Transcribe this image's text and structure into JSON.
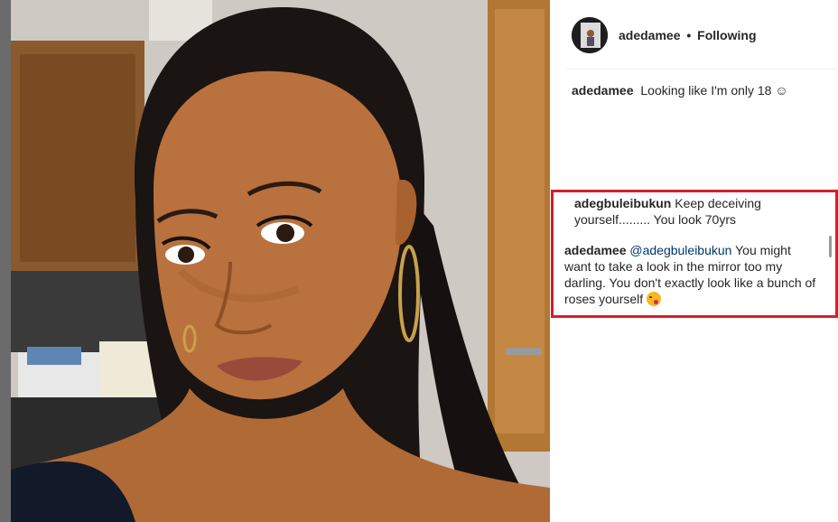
{
  "post": {
    "author": "adedamee",
    "separator": "•",
    "follow_status": "Following",
    "caption_author": "adedamee",
    "caption_text": "Looking like I'm only 18 ☺"
  },
  "comments": [
    {
      "author": "adegbuleibukun",
      "text": "Keep deceiving yourself......... You look 70yrs"
    },
    {
      "author": "adedamee",
      "mention": "@adegbuleibukun",
      "text": "You might want to take a look in the mirror too my darling. You don't exactly look like a bunch of roses yourself",
      "emoji": "kissing-heart-emoji"
    }
  ],
  "colors": {
    "highlight_border": "#d4202b",
    "text": "#262626",
    "mention": "#003569"
  }
}
